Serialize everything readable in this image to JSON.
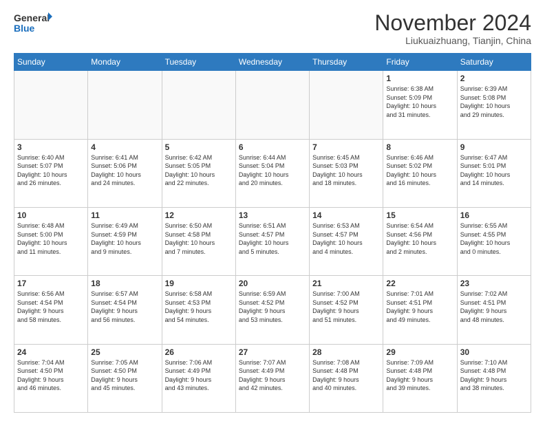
{
  "header": {
    "logo_line1": "General",
    "logo_line2": "Blue",
    "month_title": "November 2024",
    "location": "Liukuaizhuang, Tianjin, China"
  },
  "weekdays": [
    "Sunday",
    "Monday",
    "Tuesday",
    "Wednesday",
    "Thursday",
    "Friday",
    "Saturday"
  ],
  "weeks": [
    [
      {
        "day": "",
        "info": ""
      },
      {
        "day": "",
        "info": ""
      },
      {
        "day": "",
        "info": ""
      },
      {
        "day": "",
        "info": ""
      },
      {
        "day": "",
        "info": ""
      },
      {
        "day": "1",
        "info": "Sunrise: 6:38 AM\nSunset: 5:09 PM\nDaylight: 10 hours\nand 31 minutes."
      },
      {
        "day": "2",
        "info": "Sunrise: 6:39 AM\nSunset: 5:08 PM\nDaylight: 10 hours\nand 29 minutes."
      }
    ],
    [
      {
        "day": "3",
        "info": "Sunrise: 6:40 AM\nSunset: 5:07 PM\nDaylight: 10 hours\nand 26 minutes."
      },
      {
        "day": "4",
        "info": "Sunrise: 6:41 AM\nSunset: 5:06 PM\nDaylight: 10 hours\nand 24 minutes."
      },
      {
        "day": "5",
        "info": "Sunrise: 6:42 AM\nSunset: 5:05 PM\nDaylight: 10 hours\nand 22 minutes."
      },
      {
        "day": "6",
        "info": "Sunrise: 6:44 AM\nSunset: 5:04 PM\nDaylight: 10 hours\nand 20 minutes."
      },
      {
        "day": "7",
        "info": "Sunrise: 6:45 AM\nSunset: 5:03 PM\nDaylight: 10 hours\nand 18 minutes."
      },
      {
        "day": "8",
        "info": "Sunrise: 6:46 AM\nSunset: 5:02 PM\nDaylight: 10 hours\nand 16 minutes."
      },
      {
        "day": "9",
        "info": "Sunrise: 6:47 AM\nSunset: 5:01 PM\nDaylight: 10 hours\nand 14 minutes."
      }
    ],
    [
      {
        "day": "10",
        "info": "Sunrise: 6:48 AM\nSunset: 5:00 PM\nDaylight: 10 hours\nand 11 minutes."
      },
      {
        "day": "11",
        "info": "Sunrise: 6:49 AM\nSunset: 4:59 PM\nDaylight: 10 hours\nand 9 minutes."
      },
      {
        "day": "12",
        "info": "Sunrise: 6:50 AM\nSunset: 4:58 PM\nDaylight: 10 hours\nand 7 minutes."
      },
      {
        "day": "13",
        "info": "Sunrise: 6:51 AM\nSunset: 4:57 PM\nDaylight: 10 hours\nand 5 minutes."
      },
      {
        "day": "14",
        "info": "Sunrise: 6:53 AM\nSunset: 4:57 PM\nDaylight: 10 hours\nand 4 minutes."
      },
      {
        "day": "15",
        "info": "Sunrise: 6:54 AM\nSunset: 4:56 PM\nDaylight: 10 hours\nand 2 minutes."
      },
      {
        "day": "16",
        "info": "Sunrise: 6:55 AM\nSunset: 4:55 PM\nDaylight: 10 hours\nand 0 minutes."
      }
    ],
    [
      {
        "day": "17",
        "info": "Sunrise: 6:56 AM\nSunset: 4:54 PM\nDaylight: 9 hours\nand 58 minutes."
      },
      {
        "day": "18",
        "info": "Sunrise: 6:57 AM\nSunset: 4:54 PM\nDaylight: 9 hours\nand 56 minutes."
      },
      {
        "day": "19",
        "info": "Sunrise: 6:58 AM\nSunset: 4:53 PM\nDaylight: 9 hours\nand 54 minutes."
      },
      {
        "day": "20",
        "info": "Sunrise: 6:59 AM\nSunset: 4:52 PM\nDaylight: 9 hours\nand 53 minutes."
      },
      {
        "day": "21",
        "info": "Sunrise: 7:00 AM\nSunset: 4:52 PM\nDaylight: 9 hours\nand 51 minutes."
      },
      {
        "day": "22",
        "info": "Sunrise: 7:01 AM\nSunset: 4:51 PM\nDaylight: 9 hours\nand 49 minutes."
      },
      {
        "day": "23",
        "info": "Sunrise: 7:02 AM\nSunset: 4:51 PM\nDaylight: 9 hours\nand 48 minutes."
      }
    ],
    [
      {
        "day": "24",
        "info": "Sunrise: 7:04 AM\nSunset: 4:50 PM\nDaylight: 9 hours\nand 46 minutes."
      },
      {
        "day": "25",
        "info": "Sunrise: 7:05 AM\nSunset: 4:50 PM\nDaylight: 9 hours\nand 45 minutes."
      },
      {
        "day": "26",
        "info": "Sunrise: 7:06 AM\nSunset: 4:49 PM\nDaylight: 9 hours\nand 43 minutes."
      },
      {
        "day": "27",
        "info": "Sunrise: 7:07 AM\nSunset: 4:49 PM\nDaylight: 9 hours\nand 42 minutes."
      },
      {
        "day": "28",
        "info": "Sunrise: 7:08 AM\nSunset: 4:48 PM\nDaylight: 9 hours\nand 40 minutes."
      },
      {
        "day": "29",
        "info": "Sunrise: 7:09 AM\nSunset: 4:48 PM\nDaylight: 9 hours\nand 39 minutes."
      },
      {
        "day": "30",
        "info": "Sunrise: 7:10 AM\nSunset: 4:48 PM\nDaylight: 9 hours\nand 38 minutes."
      }
    ]
  ]
}
